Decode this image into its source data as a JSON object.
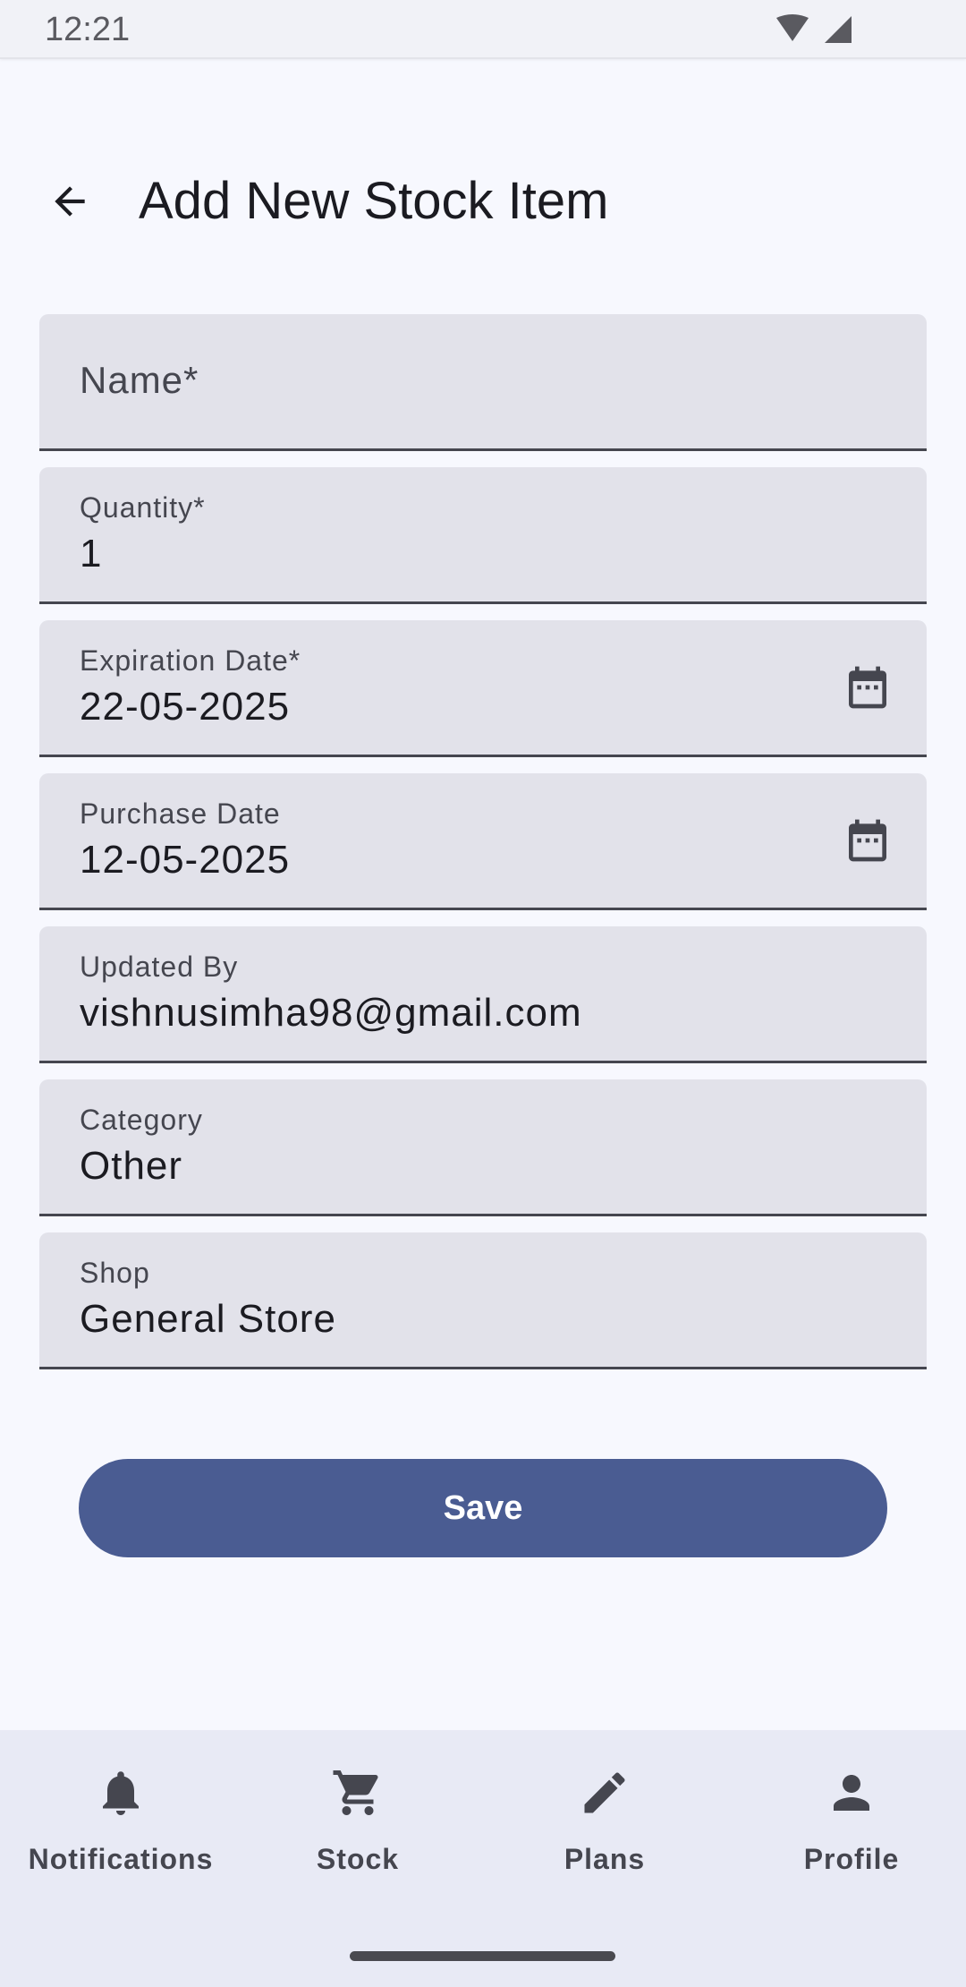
{
  "status_bar": {
    "time": "12:21"
  },
  "header": {
    "title": "Add New Stock Item"
  },
  "form": {
    "fields": [
      {
        "label": "Name*",
        "value": ""
      },
      {
        "label": "Quantity*",
        "value": "1"
      },
      {
        "label": "Expiration Date*",
        "value": "22-05-2025"
      },
      {
        "label": "Purchase Date",
        "value": "12-05-2025"
      },
      {
        "label": "Updated By",
        "value": "vishnusimha98@gmail.com"
      },
      {
        "label": "Category",
        "value": "Other"
      },
      {
        "label": "Shop",
        "value": "General Store"
      }
    ],
    "save_label": "Save"
  },
  "bottom_nav": {
    "items": [
      {
        "label": "Notifications",
        "icon": "bell-icon"
      },
      {
        "label": "Stock",
        "icon": "cart-icon"
      },
      {
        "label": "Plans",
        "icon": "pencil-icon"
      },
      {
        "label": "Profile",
        "icon": "person-icon"
      }
    ]
  },
  "colors": {
    "background": "#f7f8fe",
    "field": "#e2e2ea",
    "primary": "#4a5c92",
    "nav": "#e8eaf5"
  }
}
